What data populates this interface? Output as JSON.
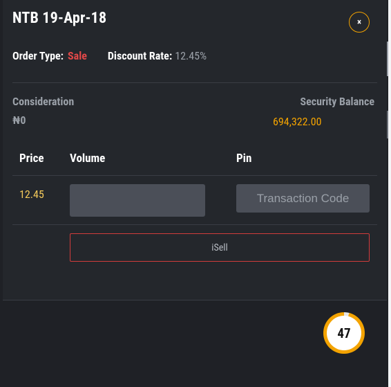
{
  "modal": {
    "title": "NTB 19-Apr-18",
    "close_label": "×",
    "order_type_label": "Order Type:",
    "order_type_value": "Sale",
    "discount_rate_label": "Discount Rate:",
    "discount_rate_value": "12.45%",
    "consideration_label": "Consideration",
    "consideration_value": "₦0",
    "security_balance_label": "Security Balance",
    "security_balance_value": "694,322.00",
    "columns": {
      "price": "Price",
      "volume": "Volume",
      "pin": "Pin"
    },
    "price_value": "12.45",
    "volume_value": "",
    "pin_placeholder": "Transaction Code",
    "submit_label": "iSell"
  },
  "countdown": {
    "value": "47",
    "progress_fraction": 0.96
  },
  "colors": {
    "accent": "#f3a300",
    "sale_red": "#e24848",
    "price_yellow": "#f2c85a",
    "panel_bg": "#24272c",
    "input_bg": "#4b4f58"
  }
}
